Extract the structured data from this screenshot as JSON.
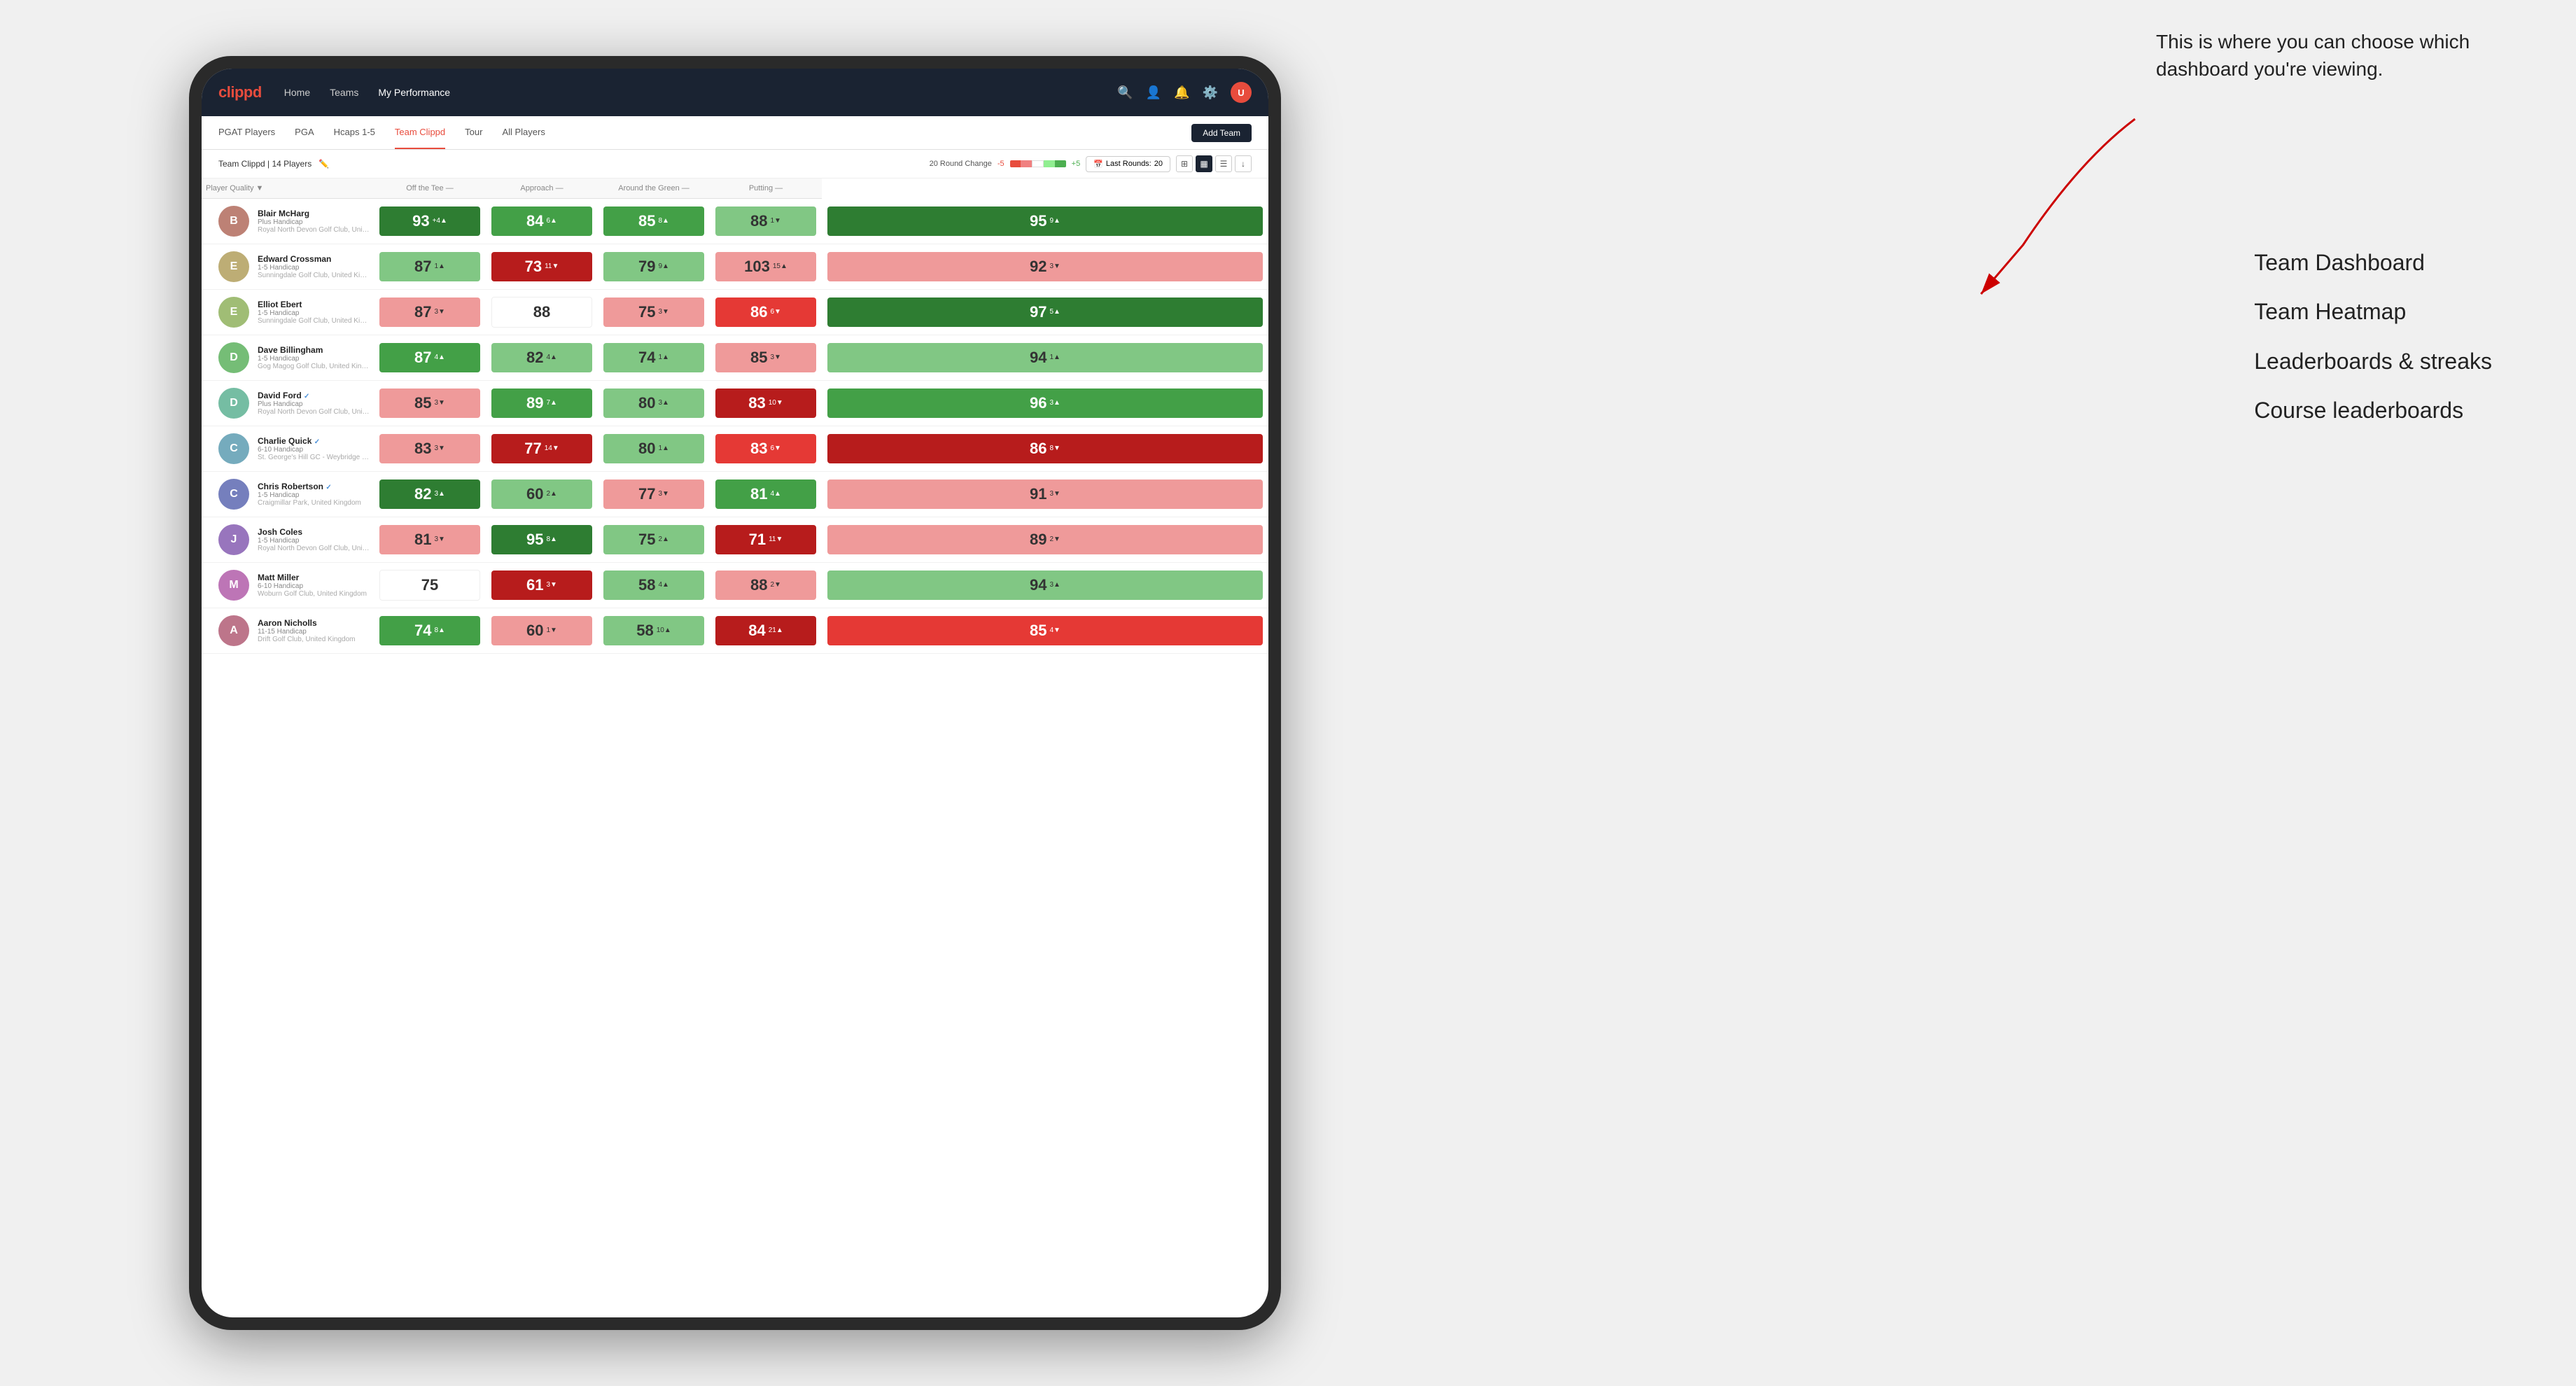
{
  "annotation": {
    "text": "This is where you can choose which dashboard you're viewing.",
    "options": [
      "Team Dashboard",
      "Team Heatmap",
      "Leaderboards & streaks",
      "Course leaderboards"
    ]
  },
  "nav": {
    "logo": "clippd",
    "links": [
      "Home",
      "Teams",
      "My Performance"
    ],
    "active_link": "My Performance"
  },
  "sub_nav": {
    "items": [
      "PGAT Players",
      "PGA",
      "Hcaps 1-5",
      "Team Clippd",
      "Tour",
      "All Players"
    ],
    "active": "Team Clippd",
    "add_team_label": "Add Team"
  },
  "team_bar": {
    "name": "Team Clippd",
    "players_count": "14 Players",
    "round_change_label": "20 Round Change",
    "change_neg": "-5",
    "change_pos": "+5",
    "last_rounds_label": "Last Rounds:",
    "last_rounds_value": "20"
  },
  "table": {
    "headers": {
      "player_quality": "Player Quality",
      "off_the_tee": "Off the Tee",
      "approach": "Approach",
      "around_the_green": "Around the Green",
      "putting": "Putting"
    },
    "rows": [
      {
        "name": "Blair McHarg",
        "handicap": "Plus Handicap",
        "club": "Royal North Devon Golf Club, United Kingdom",
        "avatar_letter": "B",
        "player_quality": {
          "value": 93,
          "change": "+4",
          "dir": "up",
          "color": "green-dark"
        },
        "off_the_tee": {
          "value": 84,
          "change": "6",
          "dir": "up",
          "color": "green-med"
        },
        "approach": {
          "value": 85,
          "change": "8",
          "dir": "up",
          "color": "green-med"
        },
        "around_the_green": {
          "value": 88,
          "change": "1",
          "dir": "down",
          "color": "green-light"
        },
        "putting": {
          "value": 95,
          "change": "9",
          "dir": "up",
          "color": "green-dark"
        }
      },
      {
        "name": "Edward Crossman",
        "handicap": "1-5 Handicap",
        "club": "Sunningdale Golf Club, United Kingdom",
        "avatar_letter": "E",
        "player_quality": {
          "value": 87,
          "change": "1",
          "dir": "up",
          "color": "green-light"
        },
        "off_the_tee": {
          "value": 73,
          "change": "11",
          "dir": "down",
          "color": "red-dark"
        },
        "approach": {
          "value": 79,
          "change": "9",
          "dir": "up",
          "color": "green-light"
        },
        "around_the_green": {
          "value": 103,
          "change": "15",
          "dir": "up",
          "color": "red-light"
        },
        "putting": {
          "value": 92,
          "change": "3",
          "dir": "down",
          "color": "red-light"
        }
      },
      {
        "name": "Elliot Ebert",
        "handicap": "1-5 Handicap",
        "club": "Sunningdale Golf Club, United Kingdom",
        "avatar_letter": "E",
        "player_quality": {
          "value": 87,
          "change": "3",
          "dir": "down",
          "color": "red-light"
        },
        "off_the_tee": {
          "value": 88,
          "change": "",
          "dir": "none",
          "color": "white"
        },
        "approach": {
          "value": 75,
          "change": "3",
          "dir": "down",
          "color": "red-light"
        },
        "around_the_green": {
          "value": 86,
          "change": "6",
          "dir": "down",
          "color": "red-med"
        },
        "putting": {
          "value": 97,
          "change": "5",
          "dir": "up",
          "color": "green-dark"
        }
      },
      {
        "name": "Dave Billingham",
        "handicap": "1-5 Handicap",
        "club": "Gog Magog Golf Club, United Kingdom",
        "avatar_letter": "D",
        "player_quality": {
          "value": 87,
          "change": "4",
          "dir": "up",
          "color": "green-med"
        },
        "off_the_tee": {
          "value": 82,
          "change": "4",
          "dir": "up",
          "color": "green-light"
        },
        "approach": {
          "value": 74,
          "change": "1",
          "dir": "up",
          "color": "green-light"
        },
        "around_the_green": {
          "value": 85,
          "change": "3",
          "dir": "down",
          "color": "red-light"
        },
        "putting": {
          "value": 94,
          "change": "1",
          "dir": "up",
          "color": "green-light"
        }
      },
      {
        "name": "David Ford",
        "handicap": "Plus Handicap",
        "club": "Royal North Devon Golf Club, United Kingdom",
        "avatar_letter": "D",
        "verified": true,
        "player_quality": {
          "value": 85,
          "change": "3",
          "dir": "down",
          "color": "red-light"
        },
        "off_the_tee": {
          "value": 89,
          "change": "7",
          "dir": "up",
          "color": "green-med"
        },
        "approach": {
          "value": 80,
          "change": "3",
          "dir": "up",
          "color": "green-light"
        },
        "around_the_green": {
          "value": 83,
          "change": "10",
          "dir": "down",
          "color": "red-dark"
        },
        "putting": {
          "value": 96,
          "change": "3",
          "dir": "up",
          "color": "green-med"
        }
      },
      {
        "name": "Charlie Quick",
        "handicap": "6-10 Handicap",
        "club": "St. George's Hill GC - Weybridge - Surrey, Uni...",
        "avatar_letter": "C",
        "verified": true,
        "player_quality": {
          "value": 83,
          "change": "3",
          "dir": "down",
          "color": "red-light"
        },
        "off_the_tee": {
          "value": 77,
          "change": "14",
          "dir": "down",
          "color": "red-dark"
        },
        "approach": {
          "value": 80,
          "change": "1",
          "dir": "up",
          "color": "green-light"
        },
        "around_the_green": {
          "value": 83,
          "change": "6",
          "dir": "down",
          "color": "red-med"
        },
        "putting": {
          "value": 86,
          "change": "8",
          "dir": "down",
          "color": "red-dark"
        }
      },
      {
        "name": "Chris Robertson",
        "handicap": "1-5 Handicap",
        "club": "Craigmillar Park, United Kingdom",
        "avatar_letter": "C",
        "verified": true,
        "player_quality": {
          "value": 82,
          "change": "3",
          "dir": "up",
          "color": "green-dark"
        },
        "off_the_tee": {
          "value": 60,
          "change": "2",
          "dir": "up",
          "color": "green-light"
        },
        "approach": {
          "value": 77,
          "change": "3",
          "dir": "down",
          "color": "red-light"
        },
        "around_the_green": {
          "value": 81,
          "change": "4",
          "dir": "up",
          "color": "green-med"
        },
        "putting": {
          "value": 91,
          "change": "3",
          "dir": "down",
          "color": "red-light"
        }
      },
      {
        "name": "Josh Coles",
        "handicap": "1-5 Handicap",
        "club": "Royal North Devon Golf Club, United Kingdom",
        "avatar_letter": "J",
        "player_quality": {
          "value": 81,
          "change": "3",
          "dir": "down",
          "color": "red-light"
        },
        "off_the_tee": {
          "value": 95,
          "change": "8",
          "dir": "up",
          "color": "green-dark"
        },
        "approach": {
          "value": 75,
          "change": "2",
          "dir": "up",
          "color": "green-light"
        },
        "around_the_green": {
          "value": 71,
          "change": "11",
          "dir": "down",
          "color": "red-dark"
        },
        "putting": {
          "value": 89,
          "change": "2",
          "dir": "down",
          "color": "red-light"
        }
      },
      {
        "name": "Matt Miller",
        "handicap": "6-10 Handicap",
        "club": "Woburn Golf Club, United Kingdom",
        "avatar_letter": "M",
        "player_quality": {
          "value": 75,
          "change": "",
          "dir": "none",
          "color": "white"
        },
        "off_the_tee": {
          "value": 61,
          "change": "3",
          "dir": "down",
          "color": "red-dark"
        },
        "approach": {
          "value": 58,
          "change": "4",
          "dir": "up",
          "color": "green-light"
        },
        "around_the_green": {
          "value": 88,
          "change": "2",
          "dir": "down",
          "color": "red-light"
        },
        "putting": {
          "value": 94,
          "change": "3",
          "dir": "up",
          "color": "green-light"
        }
      },
      {
        "name": "Aaron Nicholls",
        "handicap": "11-15 Handicap",
        "club": "Drift Golf Club, United Kingdom",
        "avatar_letter": "A",
        "player_quality": {
          "value": 74,
          "change": "8",
          "dir": "up",
          "color": "green-med"
        },
        "off_the_tee": {
          "value": 60,
          "change": "1",
          "dir": "down",
          "color": "red-light"
        },
        "approach": {
          "value": 58,
          "change": "10",
          "dir": "up",
          "color": "green-light"
        },
        "around_the_green": {
          "value": 84,
          "change": "21",
          "dir": "up",
          "color": "red-dark"
        },
        "putting": {
          "value": 85,
          "change": "4",
          "dir": "down",
          "color": "red-med"
        }
      }
    ]
  }
}
